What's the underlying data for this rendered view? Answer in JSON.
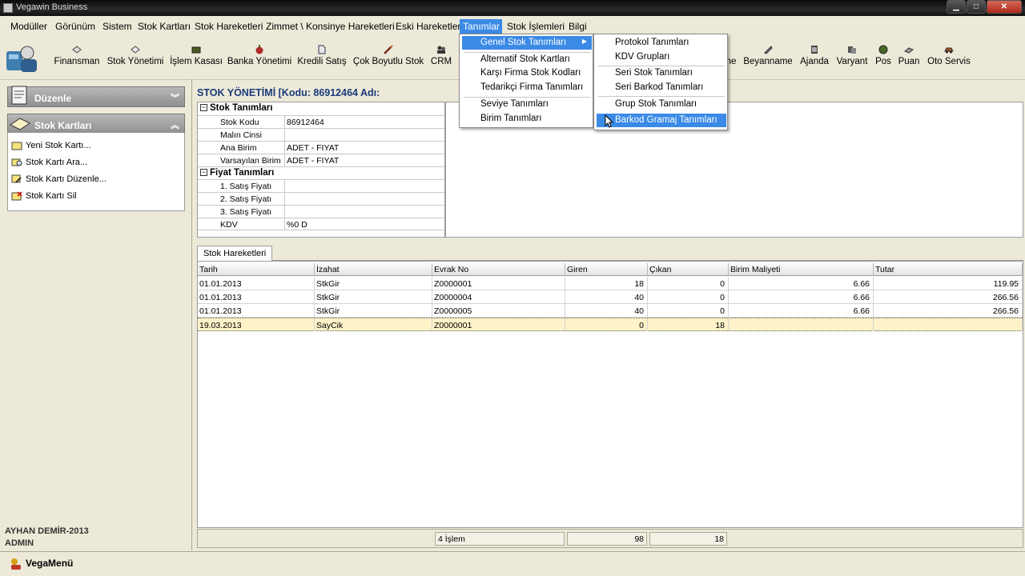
{
  "window": {
    "title": "Vegawin Business"
  },
  "menubar": {
    "items": [
      "Modüller",
      "Görünüm",
      "Sistem",
      "Stok Kartları",
      "Stok Hareketleri",
      "Zimmet \\ Konsinye Hareketleri",
      "Eski Hareketler",
      "Tanımlar",
      "Stok İşlemleri",
      "Bilgi"
    ],
    "active": "Tanımlar"
  },
  "toolbar": {
    "finansman": "Finansman",
    "stok_yonetimi": "Stok Yönetimi",
    "islem_kasasi": "İşlem Kasası",
    "banka_yonetimi": "Banka Yönetimi",
    "kredili_satis": "Kredili Satış",
    "cok_boyutlu_stok": "Çok Boyutlu Stok",
    "crm": "CRM",
    "truncated": "ne",
    "beyanname": "Beyanname",
    "ajanda": "Ajanda",
    "varyant": "Varyant",
    "pos": "Pos",
    "puan": "Puan",
    "oto_servis": "Oto Servis"
  },
  "sidebar": {
    "duzenle": "Düzenle",
    "stok_kartlari": "Stok Kartları",
    "items": [
      "Yeni Stok Kartı...",
      "Stok Kartı Ara...",
      "Stok Kartı Düzenle...",
      "Stok Kartı Sil"
    ],
    "user_name": "AYHAN DEMİR-2013",
    "user_role": "ADMIN"
  },
  "main": {
    "title": "STOK YÖNETİMİ [Kodu: 86912464 Adı:",
    "stok_tanimlari": "Stok Tanımları",
    "fiyat_tanimlari": "Fiyat Tanımları",
    "props": {
      "stok_kodu_label": "Stok Kodu",
      "stok_kodu": "86912464",
      "malin_cinsi_label": "Malın Cinsi",
      "malin_cinsi": "",
      "ana_birim_label": "Ana Birim",
      "ana_birim": "ADET - FIYAT",
      "varsayilan_birim_label": "Varsayılan Birim",
      "varsayilan_birim": "ADET - FIYAT",
      "satis1_label": "1. Satış Fiyatı",
      "satis1": "",
      "satis2_label": "2. Satış Fiyatı",
      "satis2": "",
      "satis3_label": "3. Satış Fiyatı",
      "satis3": "",
      "kdv_label": "KDV",
      "kdv": "%0 D"
    },
    "tab": "Stok Hareketleri",
    "columns": [
      "Tarih",
      "İzahat",
      "Evrak No",
      "Giren",
      "Çıkan",
      "Birim Maliyeti",
      "Tutar"
    ],
    "rows": [
      [
        "01.01.2013",
        "StkGir",
        "Z0000001",
        "18",
        "0",
        "6.66",
        "119.95"
      ],
      [
        "01.01.2013",
        "StkGir",
        "Z0000004",
        "40",
        "0",
        "6.66",
        "266.56"
      ],
      [
        "01.01.2013",
        "StkGir",
        "Z0000005",
        "40",
        "0",
        "6.66",
        "266.56"
      ],
      [
        "19.03.2013",
        "SayCik",
        "Z0000001",
        "0",
        "18",
        "",
        ""
      ]
    ],
    "footer": {
      "count": "4 İşlem",
      "giren_total": "98",
      "cikan_total": "18"
    }
  },
  "tanimlar_menu": {
    "items": [
      "Genel Stok Tanımları",
      "Alternatif Stok Kartları",
      "Karşı Firma Stok Kodları",
      "Tedarikçi Firma Tanımları",
      "Seviye Tanımları",
      "Birim Tanımları"
    ]
  },
  "sub_menu": {
    "items": [
      "Protokol Tanımları",
      "KDV Grupları",
      "Seri Stok Tanımları",
      "Seri Barkod Tanımları",
      "Grup Stok Tanımları",
      "Barkod Gramaj Tanımları"
    ]
  },
  "statusbar": {
    "vegamenu": "VegaMenü"
  },
  "colors": {
    "highlight": "#3a8ae6",
    "title_text": "#1a3a7a",
    "selected_row": "#fff2c8"
  }
}
